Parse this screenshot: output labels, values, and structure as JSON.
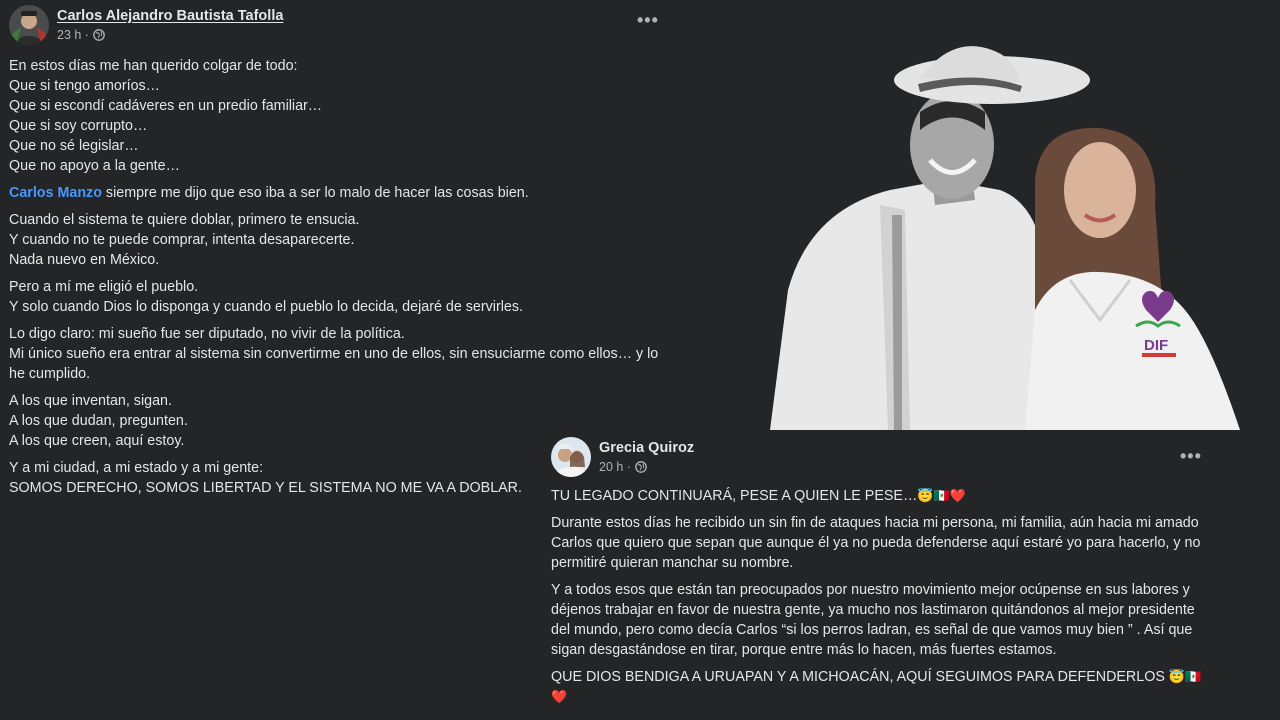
{
  "post1": {
    "author": "Carlos Alejandro Bautista Tafolla",
    "time": "23 h ·",
    "more_label": "•••",
    "lines": [
      "En estos días me han querido colgar de todo:",
      "Que si tengo amoríos…",
      "Que si escondí cadáveres en un predio familiar…",
      "Que si soy corrupto…",
      "Que no sé legislar…",
      "Que no apoyo a la gente…"
    ],
    "mention": "Carlos Manzo",
    "mention_rest": " siempre me dijo que eso iba a ser lo malo de hacer las cosas bien.",
    "para3": [
      "Cuando el sistema te quiere doblar, primero te ensucia.",
      "Y cuando no te puede comprar, intenta desaparecerte.",
      "Nada nuevo en México."
    ],
    "para4": [
      "Pero a mí me eligió el pueblo.",
      "Y solo cuando Dios lo disponga y cuando el pueblo lo decida, dejaré de servirles."
    ],
    "para5": [
      "Lo digo claro: mi sueño fue ser diputado, no vivir de la política.",
      "Mi único sueño era entrar al sistema sin convertirme en uno de ellos, sin ensuciarme como ellos… y lo he cumplido."
    ],
    "para6": [
      "A los que inventan, sigan.",
      "A los que dudan, pregunten.",
      "A los que creen, aquí estoy."
    ],
    "para7": [
      "Y a mi ciudad, a mi estado y a mi gente:",
      "SOMOS DERECHO, SOMOS LIBERTAD Y EL SISTEMA NO ME VA A DOBLAR."
    ]
  },
  "photo": {
    "badge_text": "DIF"
  },
  "post2": {
    "author": "Grecia Quiroz",
    "time": "20 h ·",
    "more_label": "•••",
    "headline": "TU LEGADO CONTINUARÁ, PESE A QUIEN LE PESE…",
    "emojis": "😇🇲🇽❤️",
    "para1": "Durante estos días he recibido un sin fin de ataques hacia mi persona, mi familia, aún hacia mi amado Carlos que quiero que sepan que aunque él ya no pueda defenderse aquí estaré yo para hacerlo, y no permitiré quieran manchar su nombre.",
    "para2": "Y a todos esos que están tan preocupados por nuestro movimiento mejor ocúpense en sus labores y déjenos trabajar en favor de nuestra gente, ya mucho nos lastimaron quitándonos al mejor presidente del mundo, pero como decía Carlos “si los perros ladran, es señal de que vamos muy bien ” . Así que sigan desgastándose en tirar, porque entre más lo hacen, más fuertes estamos.",
    "closing": "QUE DIOS BENDIGA A URUAPAN Y A MICHOACÁN, AQUÍ SEGUIMOS PARA DEFENDERLOS",
    "closing_emojis": "😇🇲🇽❤️"
  },
  "colors": {
    "background": "#242526",
    "text": "#e4e6eb",
    "secondary": "#b0b3b8",
    "mention": "#4599ff"
  }
}
